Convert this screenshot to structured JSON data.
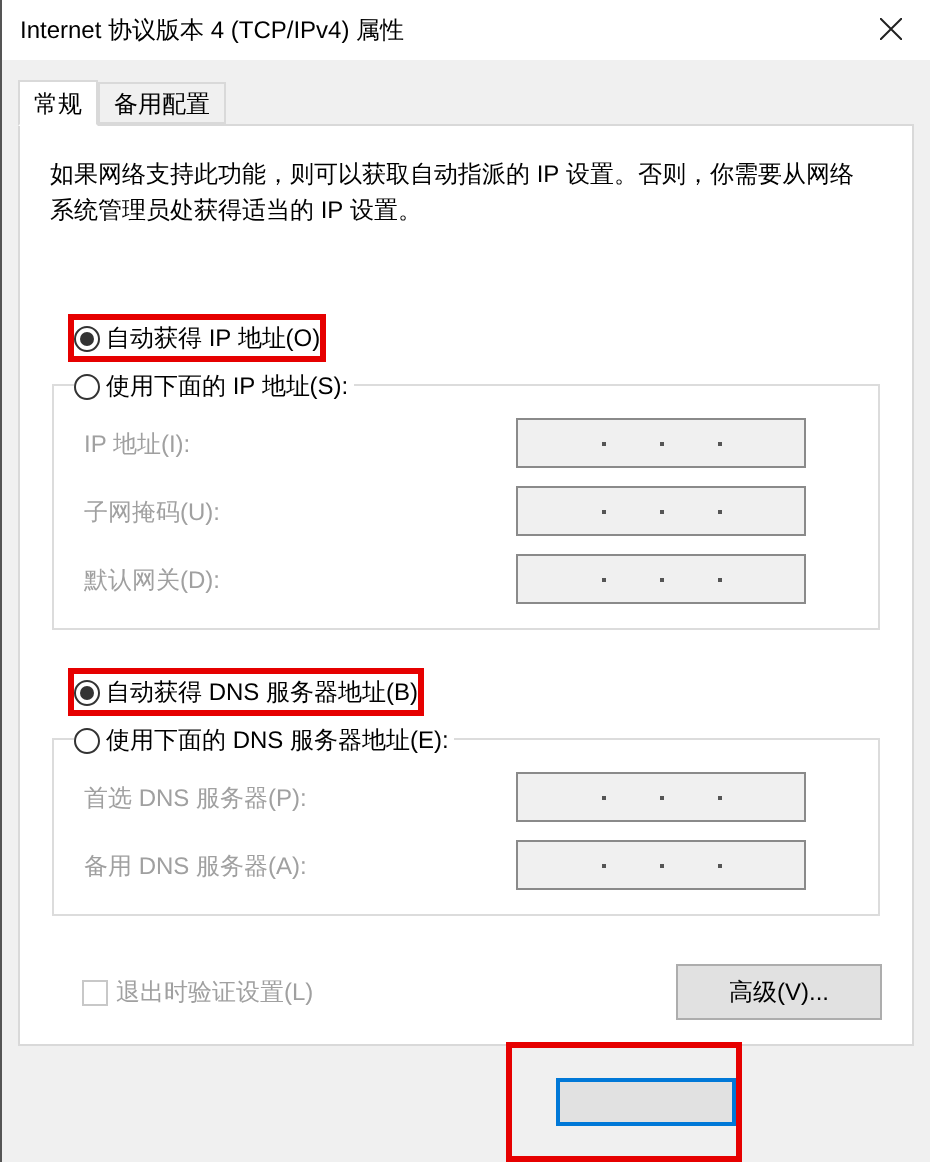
{
  "window": {
    "title": "Internet 协议版本 4 (TCP/IPv4) 属性"
  },
  "tabs": [
    {
      "label": "常规",
      "selected": true
    },
    {
      "label": "备用配置",
      "selected": false
    }
  ],
  "description": "如果网络支持此功能，则可以获取自动指派的 IP 设置。否则，你需要从网络系统管理员处获得适当的 IP 设置。",
  "ip_section": {
    "auto": {
      "label": "自动获得 IP 地址(O)",
      "selected": true,
      "highlighted": true
    },
    "manual": {
      "label": "使用下面的 IP 地址(S):",
      "selected": false
    },
    "fields": [
      {
        "label": "IP 地址(I):",
        "disabled": true
      },
      {
        "label": "子网掩码(U):",
        "disabled": true
      },
      {
        "label": "默认网关(D):",
        "disabled": true
      }
    ]
  },
  "dns_section": {
    "auto": {
      "label": "自动获得 DNS 服务器地址(B)",
      "selected": true,
      "highlighted": true
    },
    "manual": {
      "label": "使用下面的 DNS 服务器地址(E):",
      "selected": false
    },
    "fields": [
      {
        "label": "首选 DNS 服务器(P):",
        "disabled": true
      },
      {
        "label": "备用 DNS 服务器(A):",
        "disabled": true
      }
    ]
  },
  "validate_checkbox": {
    "label": "退出时验证设置(L)",
    "checked": false,
    "disabled": true
  },
  "advanced_button": "高级(V)...",
  "footer": {
    "highlighted": true
  }
}
